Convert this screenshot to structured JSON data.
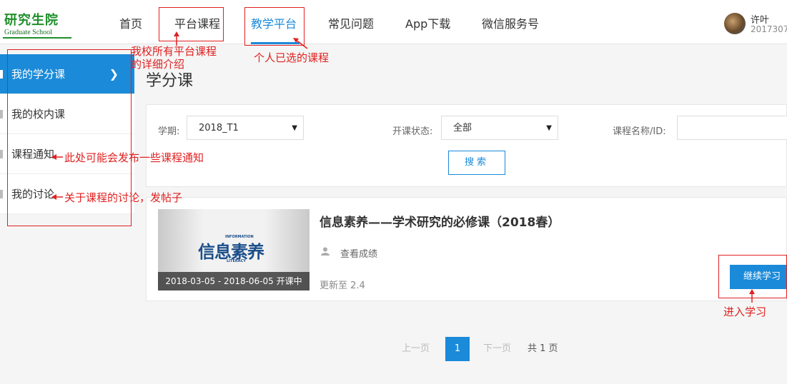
{
  "header": {
    "logo_cn": "研究生院",
    "logo_en": "Graduate School",
    "nav": [
      "首页",
      "平台课程",
      "教学平台",
      "常见问题",
      "App下载",
      "微信服务号"
    ],
    "active_nav": "教学平台",
    "user_name": "许叶",
    "user_id": "2017307"
  },
  "sidebar": {
    "items": [
      {
        "label": "我的学分课",
        "icon": "chevron-right-icon"
      },
      {
        "label": "我的校内课"
      },
      {
        "label": "课程通知"
      },
      {
        "label": "我的讨论"
      }
    ]
  },
  "main": {
    "title": "学分课",
    "filters": {
      "term_label": "学期:",
      "term_value": "2018_T1",
      "status_label": "开课状态:",
      "status_value": "全部",
      "name_label": "课程名称/ID:",
      "name_value": "",
      "search_button": "搜索"
    },
    "course": {
      "thumb_top": "INFORMATION",
      "thumb_main": "信息素养",
      "thumb_bottom": "LITERACY",
      "dates": "2018-03-05 - 2018-06-05 开课中",
      "title": "信息素养——学术研究的必修课（2018春）",
      "grade_link": "查看成绩",
      "updated": "更新至 2.4",
      "continue_button": "继续学习"
    },
    "pagination": {
      "prev": "上一页",
      "current": "1",
      "next": "下一页",
      "total": "共 1 页"
    }
  },
  "annotations": {
    "platform_courses": "我校所有平台课程",
    "platform_courses_2": "的详细介绍",
    "my_courses": "个人已选的课程",
    "notices": "此处可能会发布一些课程通知",
    "discussion": "关于课程的讨论，发帖子",
    "enter": "进入学习"
  },
  "colors": {
    "accent": "#1a8ad9",
    "annotation": "#e02020",
    "logo": "#1f8f2a"
  }
}
